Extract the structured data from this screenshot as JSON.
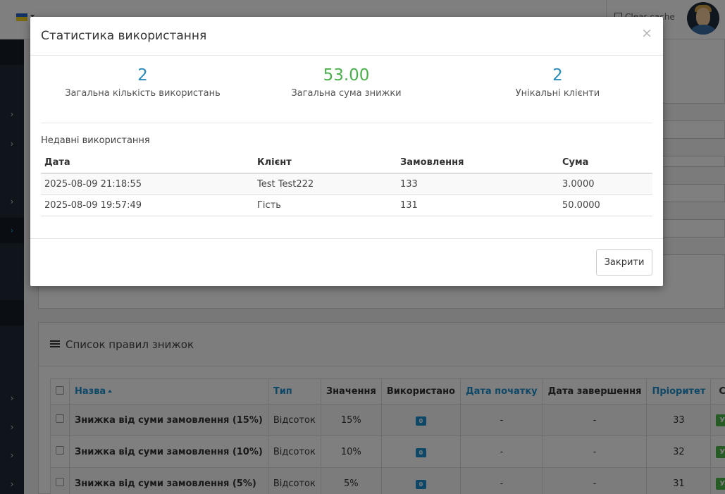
{
  "background": {
    "header": {
      "clear_cache_label": "Clear cache"
    },
    "rules_panel": {
      "title": "Список правил знижок",
      "columns": [
        "Назва",
        "Тип",
        "Значення",
        "Використано",
        "Дата початку",
        "Дата завершення",
        "Пріоритет",
        "С"
      ],
      "rows": [
        {
          "name": "Знижка від суми замовлення (15%)",
          "type": "Відсоток",
          "value": "15%",
          "used": "0",
          "date_start": "-",
          "date_end": "-",
          "priority": "33",
          "status": "У"
        },
        {
          "name": "Знижка від суми замовлення (10%)",
          "type": "Відсоток",
          "value": "10%",
          "used": "0",
          "date_start": "-",
          "date_end": "-",
          "priority": "32",
          "status": "У"
        },
        {
          "name": "Знижка від суми замовлення (5%)",
          "type": "Відсоток",
          "value": "5%",
          "used": "0",
          "date_start": "-",
          "date_end": "-",
          "priority": "31",
          "status": "У"
        }
      ]
    }
  },
  "modal": {
    "title": "Статистика використання",
    "close_symbol": "×",
    "stats": [
      {
        "value": "2",
        "label": "Загальна кількість використань",
        "color": "#2a8ab8"
      },
      {
        "value": "53.00",
        "label": "Загальна сума знижки",
        "color": "#4cae4c"
      },
      {
        "value": "2",
        "label": "Унікальні клієнти",
        "color": "#2a8ab8"
      }
    ],
    "recent_title": "Недавні використання",
    "table": {
      "headers": [
        "Дата",
        "Клієнт",
        "Замовлення",
        "Сума"
      ],
      "rows": [
        [
          "2025-08-09 21:18:55",
          "Test Test222",
          "133",
          "3.0000"
        ],
        [
          "2025-08-09 19:57:49",
          "Гість",
          "131",
          "50.0000"
        ]
      ]
    },
    "footer": {
      "close_button": "Закрити"
    }
  }
}
